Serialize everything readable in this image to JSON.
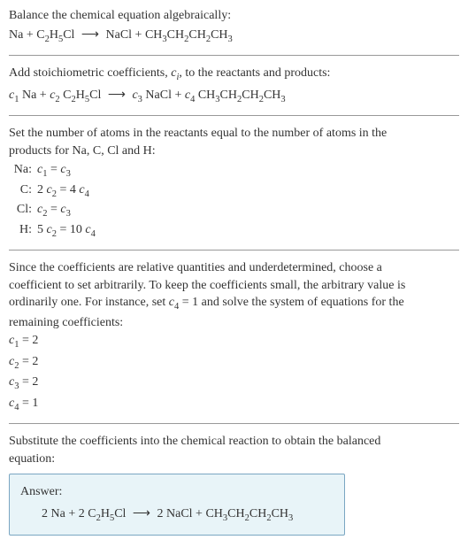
{
  "intro": {
    "line1": "Balance the chemical equation algebraically:",
    "eq_lhs1": "Na + C",
    "eq_sub1": "2",
    "eq_mid1": "H",
    "eq_sub2": "5",
    "eq_mid2": "Cl",
    "arrow": "⟶",
    "eq_rhs1": "NaCl + CH",
    "eq_rsub1": "3",
    "eq_rhs2": "CH",
    "eq_rsub2": "2",
    "eq_rhs3": "CH",
    "eq_rsub3": "2",
    "eq_rhs4": "CH",
    "eq_rsub4": "3"
  },
  "stoich": {
    "line1_a": "Add stoichiometric coefficients, ",
    "line1_ci": "c",
    "line1_ci_sub": "i",
    "line1_b": ", to the reactants and products:",
    "c1": "c",
    "c1s": "1",
    "na": " Na + ",
    "c2": "c",
    "c2s": "2",
    "ethcl_a": " C",
    "ethcl_s1": "2",
    "ethcl_b": "H",
    "ethcl_s2": "5",
    "ethcl_c": "Cl ",
    "arrow": "⟶",
    "c3": "c",
    "c3s": "3",
    "nacl": " NaCl + ",
    "c4": "c",
    "c4s": "4",
    "but_a": " CH",
    "but_s1": "3",
    "but_b": "CH",
    "but_s2": "2",
    "but_c": "CH",
    "but_s3": "2",
    "but_d": "CH",
    "but_s4": "3"
  },
  "atoms": {
    "intro1": "Set the number of atoms in the reactants equal to the number of atoms in the",
    "intro2": "products for Na, C, Cl and H:",
    "rows": [
      {
        "label": "Na:",
        "eq_a": "c",
        "eq_as": "1",
        "eq_mid": " = ",
        "eq_b": "c",
        "eq_bs": "3",
        "prefix_a": "",
        "prefix_b": ""
      },
      {
        "label": "C:",
        "eq_a": "c",
        "eq_as": "2",
        "eq_mid": " = 4 ",
        "eq_b": "c",
        "eq_bs": "4",
        "prefix_a": "2 ",
        "prefix_b": ""
      },
      {
        "label": "Cl:",
        "eq_a": "c",
        "eq_as": "2",
        "eq_mid": " = ",
        "eq_b": "c",
        "eq_bs": "3",
        "prefix_a": "",
        "prefix_b": ""
      },
      {
        "label": "H:",
        "eq_a": "c",
        "eq_as": "2",
        "eq_mid": " = 10 ",
        "eq_b": "c",
        "eq_bs": "4",
        "prefix_a": "5 ",
        "prefix_b": ""
      }
    ]
  },
  "solve": {
    "para1": "Since the coefficients are relative quantities and underdetermined, choose a",
    "para2": "coefficient to set arbitrarily. To keep the coefficients small, the arbitrary value is",
    "para3a": "ordinarily one. For instance, set ",
    "para3_c": "c",
    "para3_cs": "4",
    "para3b": " = 1 and solve the system of equations for the",
    "para4": "remaining coefficients:",
    "coefs": [
      {
        "c": "c",
        "s": "1",
        "v": " = 2"
      },
      {
        "c": "c",
        "s": "2",
        "v": " = 2"
      },
      {
        "c": "c",
        "s": "3",
        "v": " = 2"
      },
      {
        "c": "c",
        "s": "4",
        "v": " = 1"
      }
    ]
  },
  "final": {
    "line1": "Substitute the coefficients into the chemical reaction to obtain the balanced",
    "line2": "equation:",
    "answer_label": "Answer:",
    "eq_a": "2 Na + 2 C",
    "eq_s1": "2",
    "eq_b": "H",
    "eq_s2": "5",
    "eq_c": "Cl ",
    "arrow": "⟶",
    "eq_d": " 2 NaCl + CH",
    "eq_s3": "3",
    "eq_e": "CH",
    "eq_s4": "2",
    "eq_f": "CH",
    "eq_s5": "2",
    "eq_g": "CH",
    "eq_s6": "3"
  },
  "chart_data": {
    "type": "table",
    "title": "Balanced chemical equation derivation",
    "unbalanced_equation": "Na + C2H5Cl ⟶ NaCl + CH3CH2CH2CH3",
    "atom_balance": [
      {
        "element": "Na",
        "equation": "c1 = c3"
      },
      {
        "element": "C",
        "equation": "2 c2 = 4 c4"
      },
      {
        "element": "Cl",
        "equation": "c2 = c3"
      },
      {
        "element": "H",
        "equation": "5 c2 = 10 c4"
      }
    ],
    "solved_coefficients": {
      "c1": 2,
      "c2": 2,
      "c3": 2,
      "c4": 1
    },
    "balanced_equation": "2 Na + 2 C2H5Cl ⟶ 2 NaCl + CH3CH2CH2CH3"
  }
}
